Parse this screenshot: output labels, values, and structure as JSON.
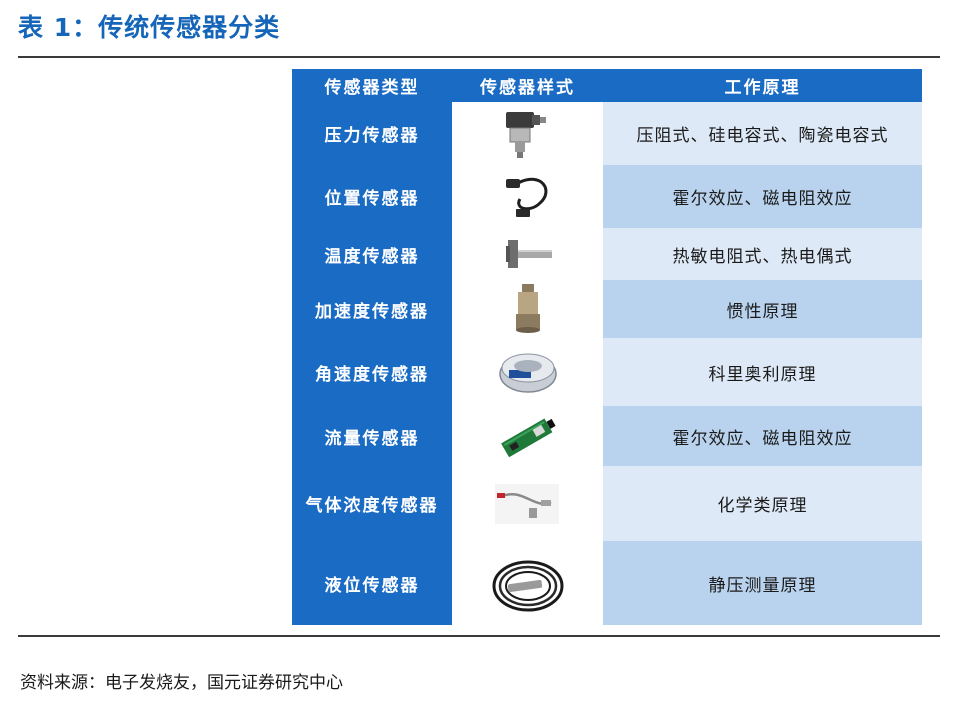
{
  "title": "表 1：传统传感器分类",
  "header": {
    "col1": "传感器类型",
    "col2": "传感器样式",
    "col3": "工作原理"
  },
  "rows": [
    {
      "type": "压力传感器",
      "principle": "压阻式、硅电容式、陶瓷电容式",
      "icon": "pressure-sensor-icon"
    },
    {
      "type": "位置传感器",
      "principle": "霍尔效应、磁电阻效应",
      "icon": "position-sensor-icon"
    },
    {
      "type": "温度传感器",
      "principle": "热敏电阻式、热电偶式",
      "icon": "temperature-sensor-icon"
    },
    {
      "type": "加速度传感器",
      "principle": "惯性原理",
      "icon": "accelerometer-icon"
    },
    {
      "type": "角速度传感器",
      "principle": "科里奥利原理",
      "icon": "gyroscope-icon"
    },
    {
      "type": "流量传感器",
      "principle": "霍尔效应、磁电阻效应",
      "icon": "flow-sensor-icon"
    },
    {
      "type": "气体浓度传感器",
      "principle": "化学类原理",
      "icon": "gas-sensor-icon"
    },
    {
      "type": "液位传感器",
      "principle": "静压测量原理",
      "icon": "level-sensor-icon"
    }
  ],
  "source": "资料来源：电子发烧友，国元证券研究中心",
  "colors": {
    "title": "#1565b8",
    "header_bg": "#1a6bc4",
    "row_dark": "#b9d3ee",
    "row_light": "#dde9f6"
  }
}
